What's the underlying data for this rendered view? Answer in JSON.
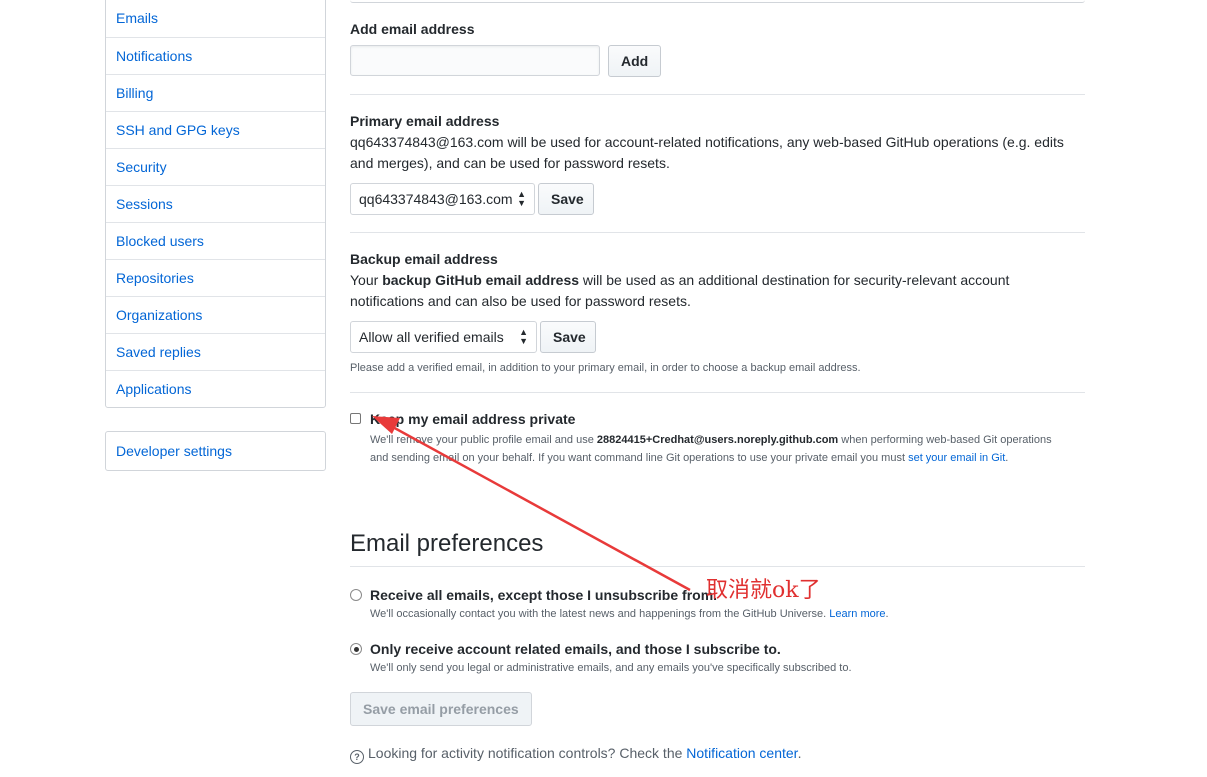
{
  "sidebar": {
    "items": [
      {
        "label": "Emails"
      },
      {
        "label": "Notifications"
      },
      {
        "label": "Billing"
      },
      {
        "label": "SSH and GPG keys"
      },
      {
        "label": "Security"
      },
      {
        "label": "Sessions"
      },
      {
        "label": "Blocked users"
      },
      {
        "label": "Repositories"
      },
      {
        "label": "Organizations"
      },
      {
        "label": "Saved replies"
      },
      {
        "label": "Applications"
      }
    ],
    "developer_settings": "Developer settings"
  },
  "add_email": {
    "heading": "Add email address",
    "input_value": "",
    "button": "Add"
  },
  "primary_email": {
    "heading": "Primary email address",
    "description": "qq643374843@163.com will be used for account-related notifications, any web-based GitHub operations (e.g. edits and merges), and can be used for password resets.",
    "select_value": "qq643374843@163.com",
    "button": "Save"
  },
  "backup_email": {
    "heading": "Backup email address",
    "desc_prefix": "Your ",
    "desc_bold": "backup GitHub email address",
    "desc_suffix": " will be used as an additional destination for security-relevant account notifications and can also be used for password resets.",
    "select_value": "Allow all verified emails",
    "button": "Save",
    "note": "Please add a verified email, in addition to your primary email, in order to choose a backup email address."
  },
  "private_email": {
    "label": "Keep my email address private",
    "checked": false,
    "desc_prefix": "We'll remove your public profile email and use ",
    "noreply": "28824415+Credhat@users.noreply.github.com",
    "desc_middle": " when performing web-based Git operations and sending email on your behalf. If you want command line Git operations to use your private email you must ",
    "link": "set your email in Git",
    "desc_suffix": "."
  },
  "email_preferences": {
    "title": "Email preferences",
    "options": [
      {
        "label": "Receive all emails, except those I unsubscribe from.",
        "desc": "We'll occasionally contact you with the latest news and happenings from the GitHub Universe. ",
        "link": "Learn more",
        "link_suffix": ".",
        "checked": false
      },
      {
        "label": "Only receive account related emails, and those I subscribe to.",
        "desc": "We'll only send you legal or administrative emails, and any emails you've specifically subscribed to.",
        "checked": true
      }
    ],
    "save_button": "Save email preferences"
  },
  "help": {
    "text": "Looking for activity notification controls? Check the ",
    "link": "Notification center",
    "suffix": "."
  },
  "annotation": {
    "text": "取消就ok了",
    "color": "#e03030"
  }
}
